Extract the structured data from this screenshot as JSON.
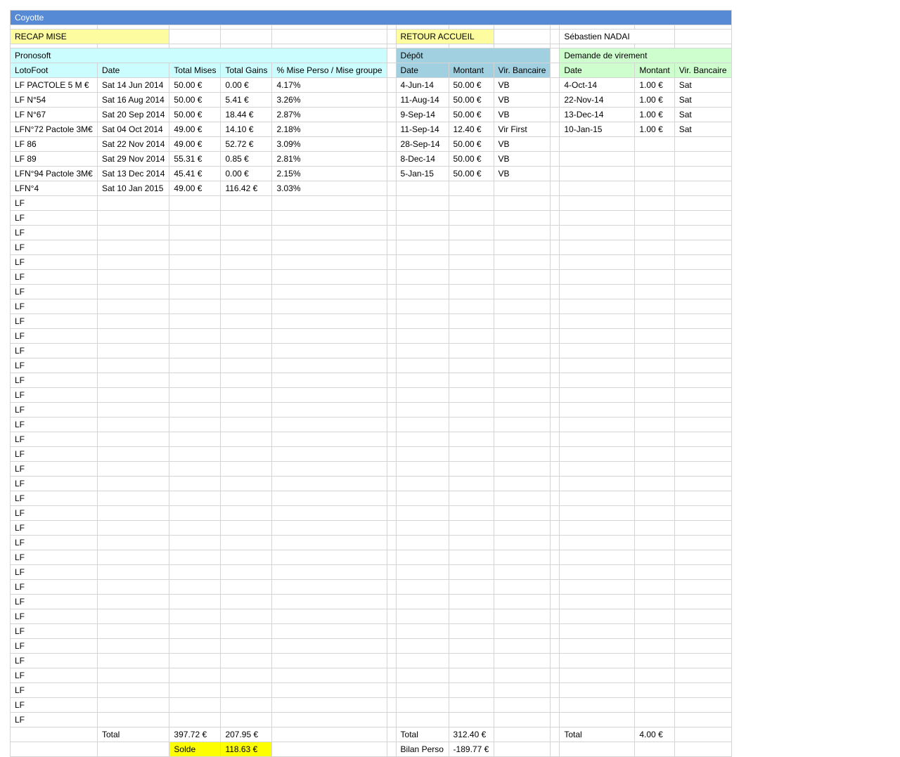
{
  "title": "Coyotte",
  "nav": {
    "recap_label": "RECAP MISE",
    "home_label": "RETOUR ACCUEIL",
    "user_name": "Sébastien NADAI"
  },
  "pronosoft": {
    "title": "Pronosoft",
    "headers": [
      "LotoFoot",
      "Date",
      "Total Mises",
      "Total Gains",
      "% Mise Perso / Mise groupe"
    ],
    "rows": [
      [
        "LF PACTOLE 5 M €",
        "Sat 14 Jun 2014",
        "50.00 €",
        "0.00 €",
        "4.17%"
      ],
      [
        "LF N°54",
        "Sat 16 Aug 2014",
        "50.00 €",
        "5.41 €",
        "3.26%"
      ],
      [
        "LF N°67",
        "Sat 20 Sep 2014",
        "50.00 €",
        "18.44 €",
        "2.87%"
      ],
      [
        "LFN°72 Pactole 3M€",
        "Sat 04 Oct 2014",
        "49.00 €",
        "14.10 €",
        "2.18%"
      ],
      [
        "LF 86",
        "Sat 22 Nov 2014",
        "49.00 €",
        "52.72 €",
        "3.09%"
      ],
      [
        "LF 89",
        "Sat 29 Nov 2014",
        "55.31 €",
        "0.85 €",
        "2.81%"
      ],
      [
        "LFN°94 Pactole 3M€",
        "Sat 13 Dec 2014",
        "45.41 €",
        "0.00 €",
        "2.15%"
      ],
      [
        "LFN°4",
        "Sat 10 Jan 2015",
        "49.00 €",
        "116.42 €",
        "3.03%"
      ],
      [
        "LF",
        "",
        "",
        "",
        ""
      ],
      [
        "LF",
        "",
        "",
        "",
        ""
      ],
      [
        "LF",
        "",
        "",
        "",
        ""
      ],
      [
        "LF",
        "",
        "",
        "",
        ""
      ],
      [
        "LF",
        "",
        "",
        "",
        ""
      ],
      [
        "LF",
        "",
        "",
        "",
        ""
      ],
      [
        "LF",
        "",
        "",
        "",
        ""
      ],
      [
        "LF",
        "",
        "",
        "",
        ""
      ],
      [
        "LF",
        "",
        "",
        "",
        ""
      ],
      [
        "LF",
        "",
        "",
        "",
        ""
      ],
      [
        "LF",
        "",
        "",
        "",
        ""
      ],
      [
        "LF",
        "",
        "",
        "",
        ""
      ],
      [
        "LF",
        "",
        "",
        "",
        ""
      ],
      [
        "LF",
        "",
        "",
        "",
        ""
      ],
      [
        "LF",
        "",
        "",
        "",
        ""
      ],
      [
        "LF",
        "",
        "",
        "",
        ""
      ],
      [
        "LF",
        "",
        "",
        "",
        ""
      ],
      [
        "LF",
        "",
        "",
        "",
        ""
      ],
      [
        "LF",
        "",
        "",
        "",
        ""
      ],
      [
        "LF",
        "",
        "",
        "",
        ""
      ],
      [
        "LF",
        "",
        "",
        "",
        ""
      ],
      [
        "LF",
        "",
        "",
        "",
        ""
      ],
      [
        "LF",
        "",
        "",
        "",
        ""
      ],
      [
        "LF",
        "",
        "",
        "",
        ""
      ],
      [
        "LF",
        "",
        "",
        "",
        ""
      ],
      [
        "LF",
        "",
        "",
        "",
        ""
      ],
      [
        "LF",
        "",
        "",
        "",
        ""
      ],
      [
        "LF",
        "",
        "",
        "",
        ""
      ],
      [
        "LF",
        "",
        "",
        "",
        ""
      ],
      [
        "LF",
        "",
        "",
        "",
        ""
      ],
      [
        "LF",
        "",
        "",
        "",
        ""
      ],
      [
        "LF",
        "",
        "",
        "",
        ""
      ],
      [
        "LF",
        "",
        "",
        "",
        ""
      ],
      [
        "LF",
        "",
        "",
        "",
        ""
      ],
      [
        "LF",
        "",
        "",
        "",
        ""
      ],
      [
        "LF",
        "",
        "",
        "",
        ""
      ]
    ],
    "total_label": "Total",
    "total_mises": "397.72 €",
    "total_gains": "207.95 €",
    "solde_label": "Solde",
    "solde_value": "118.63 €"
  },
  "depot": {
    "title": "Dépôt",
    "headers": [
      "Date",
      "Montant",
      "Vir. Bancaire"
    ],
    "rows": [
      [
        "4-Jun-14",
        "50.00 €",
        "VB"
      ],
      [
        "11-Aug-14",
        "50.00 €",
        "VB"
      ],
      [
        "9-Sep-14",
        "50.00 €",
        "VB"
      ],
      [
        "11-Sep-14",
        "12.40 €",
        "Vir First"
      ],
      [
        "28-Sep-14",
        "50.00 €",
        "VB"
      ],
      [
        "8-Dec-14",
        "50.00 €",
        "VB"
      ],
      [
        "5-Jan-15",
        "50.00 €",
        "VB"
      ]
    ],
    "total_label": "Total",
    "total_value": "312.40 €",
    "bilan_label": "Bilan Perso",
    "bilan_value": "-189.77 €"
  },
  "virement": {
    "title": "Demande de virement",
    "headers": [
      "Date",
      "Montant",
      "Vir. Bancaire"
    ],
    "rows": [
      [
        "4-Oct-14",
        "1.00 €",
        "Sat"
      ],
      [
        "22-Nov-14",
        "1.00 €",
        "Sat"
      ],
      [
        "13-Dec-14",
        "1.00 €",
        "Sat"
      ],
      [
        "10-Jan-15",
        "1.00 €",
        "Sat"
      ]
    ],
    "total_label": "Total",
    "total_value": "4.00 €"
  },
  "colors": {
    "title_bar": "#568ad4",
    "yellow": "#fdfd9f",
    "cyan": "#ccfdfe",
    "blue": "#a1d0e0",
    "green": "#cefecd",
    "bright_yellow": "#fdfe00",
    "grid": "#d4d4d4"
  }
}
